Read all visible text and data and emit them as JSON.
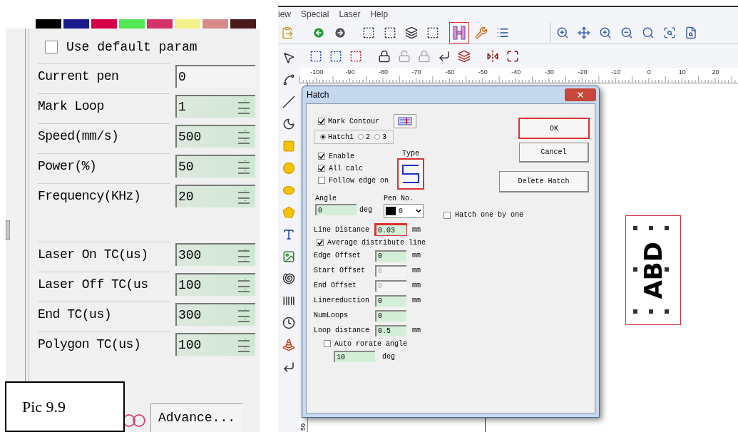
{
  "param_panel": {
    "pen_colors": [
      {
        "color": "#000000"
      },
      {
        "color": "#1a1a8c"
      },
      {
        "color": "#d4004a"
      },
      {
        "color": "#55e855"
      },
      {
        "color": "#d4336a"
      },
      {
        "color": "#f5f08a"
      },
      {
        "color": "#d88a8a"
      },
      {
        "color": "#4a1a1a"
      }
    ],
    "use_default_param": {
      "label": "Use default param",
      "checked": false
    },
    "params": [
      {
        "label": "Current pen",
        "value": "0",
        "kind": "field"
      },
      {
        "label": "Mark Loop",
        "value": "1",
        "kind": "spin"
      },
      {
        "label": "Speed(mm/s)",
        "value": "500",
        "kind": "spin"
      },
      {
        "label": "Power(%)",
        "value": "50",
        "kind": "spin"
      },
      {
        "label": "Frequency(KHz)",
        "value": "20",
        "kind": "spin"
      },
      {
        "label": "Laser On TC(us)",
        "value": "300",
        "kind": "spin"
      },
      {
        "label": "Laser Off TC(us",
        "value": "100",
        "kind": "spin"
      },
      {
        "label": "End TC(us)",
        "value": "300",
        "kind": "spin"
      },
      {
        "label": "Polygon TC(us)",
        "value": "100",
        "kind": "spin"
      }
    ],
    "advance_button": "Advance...",
    "caption": "Pic 9.9"
  },
  "app": {
    "menu": [
      "iew",
      "Special",
      "Laser",
      "Help"
    ],
    "hatch_tool": {
      "highlighted": true
    },
    "ruler_labels": [
      "-100",
      "-90",
      "-80",
      "-70",
      "-60",
      "-50",
      "-40",
      "-30",
      "-20",
      "-10",
      "0",
      "10",
      "20"
    ],
    "vertical_ruler_label": "50",
    "canvas_object": {
      "text": "ABD",
      "highlighted": true
    }
  },
  "dialog": {
    "title": "Hatch",
    "mark_contour": {
      "label": "Mark Contour",
      "checked": true
    },
    "hatch_radios": [
      {
        "label": "Hatch1",
        "selected": true
      },
      {
        "label": "2",
        "selected": false
      },
      {
        "label": "3",
        "selected": false
      }
    ],
    "options": [
      {
        "label": "Enable",
        "checked": true
      },
      {
        "label": "All calc",
        "checked": true
      },
      {
        "label": "Follow edge on",
        "checked": false
      }
    ],
    "type": {
      "label": "Type",
      "highlighted": true
    },
    "angle": {
      "label": "Angle",
      "value": "0",
      "unit": "deg"
    },
    "pen": {
      "label": "Pen No.",
      "value": "0"
    },
    "line_distance": {
      "label": "Line Distance",
      "value": "0.03",
      "unit": "mm",
      "highlighted": true
    },
    "average_distribute": {
      "label": "Average distribute line",
      "checked": true
    },
    "fields": [
      {
        "label": "Edge Offset",
        "value": "0",
        "unit": "mm",
        "disabled": false
      },
      {
        "label": "Start Offset",
        "value": "0",
        "unit": "mm",
        "disabled": true
      },
      {
        "label": "End Offset",
        "value": "0",
        "unit": "mm",
        "disabled": true
      },
      {
        "label": "Linereduction",
        "value": "0",
        "unit": "mm",
        "disabled": false
      },
      {
        "label": "NumLoops",
        "value": "0",
        "disabled": false
      },
      {
        "label": "Loop distance",
        "value": "0.5",
        "unit": "mm",
        "disabled": false
      }
    ],
    "auto_rotate": {
      "label": "Auto rorate angle",
      "checked": false,
      "value": "10",
      "unit": "deg"
    },
    "buttons": [
      {
        "label": "OK",
        "highlighted": true
      },
      {
        "label": "Cancel",
        "highlighted": false
      },
      {
        "label": "Delete Hatch",
        "highlighted": false
      }
    ],
    "hatch_one_by_one": {
      "label": "Hatch one by one",
      "checked": false
    }
  }
}
